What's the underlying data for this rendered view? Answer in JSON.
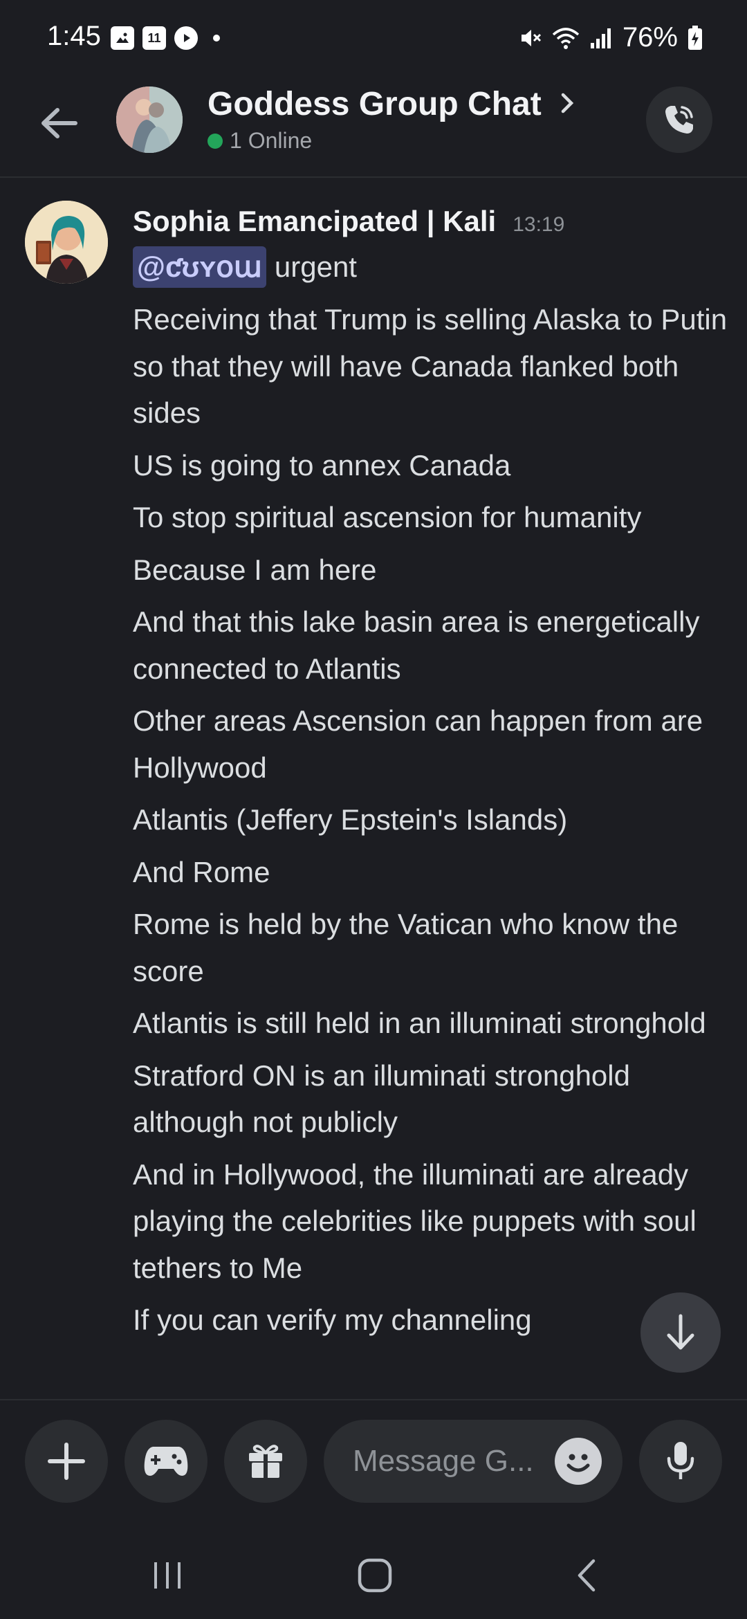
{
  "status_bar": {
    "time": "1:45",
    "battery": "76%",
    "notif_badge": "11"
  },
  "header": {
    "title": "Goddess Group Chat",
    "online_status": "1 Online"
  },
  "message": {
    "author": "Sophia Emancipated | Kali",
    "timestamp": "13:19",
    "mention": "@ƈʊʏօա",
    "mention_suffix": "urgent",
    "lines": [
      "Receiving that Trump is selling Alaska to Putin so that they will have Canada flanked both sides",
      "US is going to annex Canada",
      "To stop spiritual ascension for humanity",
      "Because I am here",
      "And that this lake basin area is energetically connected to Atlantis",
      "Other areas Ascension can happen from are Hollywood",
      "Atlantis (Jeffery Epstein's Islands)",
      "And Rome",
      "Rome is held by the Vatican who know the score",
      "Atlantis is still held in an illuminati stronghold",
      "Stratford ON is an illuminati stronghold although not publicly",
      "And in Hollywood,  the illuminati are already playing the celebrities like puppets with soul tethers to Me",
      "If you can verify my channeling"
    ]
  },
  "composer": {
    "placeholder": "Message G..."
  },
  "colors": {
    "background": "#1c1d22",
    "online": "#23a55a",
    "mention_bg": "#3c4270"
  }
}
